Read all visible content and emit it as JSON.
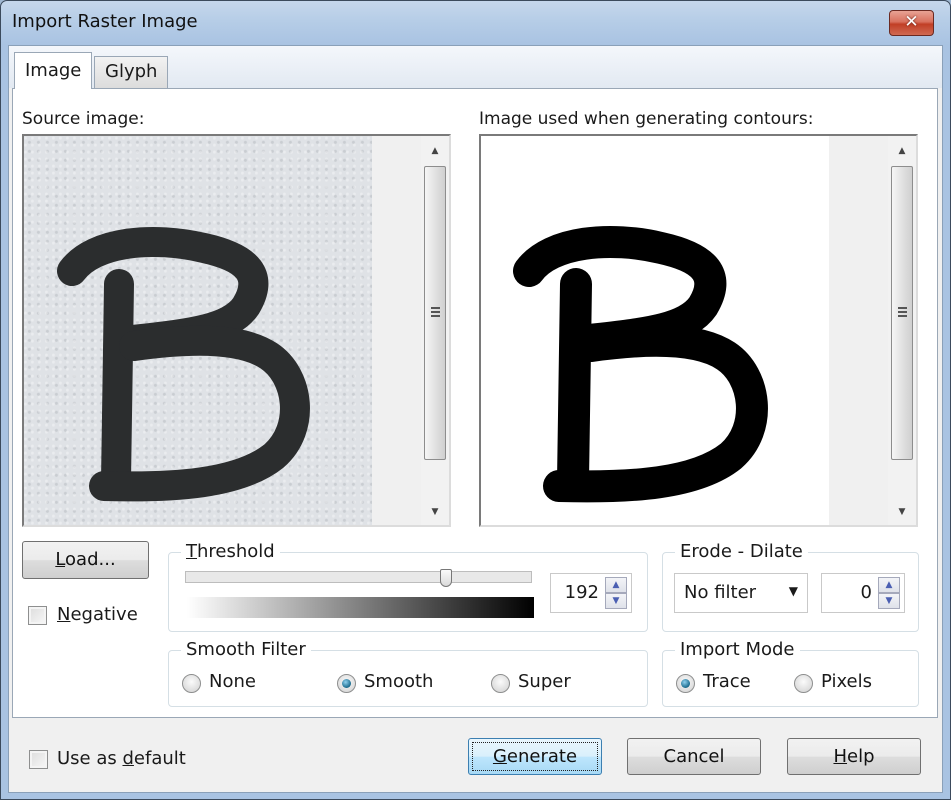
{
  "window": {
    "title": "Import Raster Image",
    "close_icon": "close-x-icon"
  },
  "tabs": [
    {
      "label": "Image",
      "active": true
    },
    {
      "label": "Glyph",
      "active": false
    }
  ],
  "source": {
    "label": "Source image:",
    "content": "Scanned handwritten letter B on grey paper"
  },
  "output": {
    "label": "Image used when generating contours:",
    "content": "Black and white thresholded letter B"
  },
  "load_button": {
    "label": "Load...",
    "mnemonic": "L"
  },
  "negative": {
    "label": "Negative",
    "checked": false
  },
  "threshold": {
    "title": "Threshold",
    "value": "192",
    "min": 0,
    "max": 255,
    "fraction": 0.753
  },
  "erode_dilate": {
    "title": "Erode - Dilate",
    "filter_selected": "No filter",
    "amount": "0"
  },
  "smooth_filter": {
    "title": "Smooth Filter",
    "options": [
      {
        "label": "None",
        "selected": false
      },
      {
        "label": "Smooth",
        "selected": true
      },
      {
        "label": "Super",
        "selected": false
      }
    ]
  },
  "import_mode": {
    "title": "Import Mode",
    "options": [
      {
        "label": "Trace",
        "selected": true
      },
      {
        "label": "Pixels",
        "selected": false
      }
    ]
  },
  "use_as_default": {
    "label_pre": "Use as ",
    "label_u": "d",
    "label_post": "efault",
    "checked": false
  },
  "buttons": {
    "generate": {
      "u": "G",
      "rest": "enerate"
    },
    "cancel": "Cancel",
    "help": {
      "u": "H",
      "rest": "elp"
    }
  }
}
